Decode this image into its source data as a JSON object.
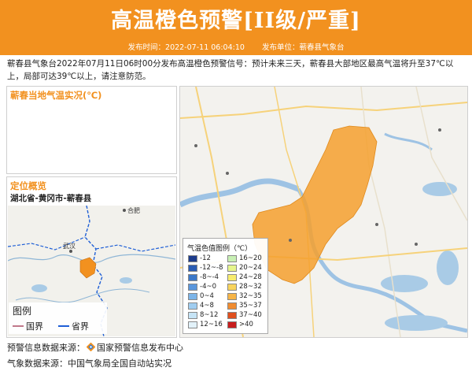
{
  "header": {
    "title": "高温橙色预警[II级/严重]",
    "publish_time_label": "发布时间：2022-07-11 06:04:10",
    "publisher_label": "发布单位：蕲春县气象台",
    "bg_color": "#f2911f"
  },
  "notice": {
    "text": "蕲春县气象台2022年07月11日06时00分发布高温橙色预警信号：预计未来三天，蕲春县大部地区最高气温将升至37℃以上，局部可达39℃以上，请注意防范。"
  },
  "temp_panel": {
    "title": "蕲春当地气温实况(℃)"
  },
  "location_panel": {
    "title": "定位概览",
    "subtitle": "湖北省-黄冈市-蕲春县",
    "map_labels": {
      "city_wuhan": "武汉",
      "city_hefei": "合肥"
    },
    "legend": {
      "title": "图例",
      "items": [
        {
          "label": "国界",
          "color": "#c0788a"
        },
        {
          "label": "省界",
          "color": "#1f5fd6"
        }
      ]
    },
    "highlight_color": "#f2911f"
  },
  "map": {
    "warning_area_color": "#f5a02e",
    "legend": {
      "title": "气温色值图例（℃）",
      "left_items": [
        {
          "label": "-12",
          "color": "#1e3c8c"
        },
        {
          "label": "-12~-8",
          "color": "#2a5cb4"
        },
        {
          "label": "-8~-4",
          "color": "#3c78c8"
        },
        {
          "label": "-4~0",
          "color": "#5a96dc"
        },
        {
          "label": "0~4",
          "color": "#7cb4e8"
        },
        {
          "label": "4~8",
          "color": "#a0cdf0"
        },
        {
          "label": "8~12",
          "color": "#c6e4f6"
        },
        {
          "label": "12~16",
          "color": "#e2f2fa"
        }
      ],
      "right_items": [
        {
          "label": "16~20",
          "color": "#c8f0b4"
        },
        {
          "label": "20~24",
          "color": "#e6f58c"
        },
        {
          "label": "24~28",
          "color": "#f7ec6e"
        },
        {
          "label": "28~32",
          "color": "#f8d45c"
        },
        {
          "label": "32~35",
          "color": "#f6b446"
        },
        {
          "label": "35~37",
          "color": "#f08c30"
        },
        {
          "label": "37~40",
          "color": "#e0501e"
        },
        {
          "label": ">40",
          "color": "#c81e1e"
        }
      ]
    }
  },
  "footer": {
    "warning_source": "预警信息数据来源：",
    "warning_source_name": "国家预警信息发布中心",
    "weather_source": "气象数据来源：中国气象局全国自动站实况"
  }
}
